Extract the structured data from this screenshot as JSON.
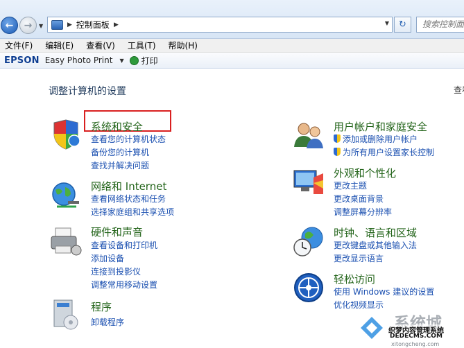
{
  "address_bar": {
    "path_item": "控制面板",
    "search_placeholder": "搜索控制面板"
  },
  "menu": [
    "文件(F)",
    "编辑(E)",
    "查看(V)",
    "工具(T)",
    "帮助(H)"
  ],
  "toolbar": {
    "brand": "EPSON",
    "app": "Easy Photo Print",
    "print": "打印"
  },
  "main": {
    "heading": "调整计算机的设置",
    "view_by": "查看方式"
  },
  "categories": {
    "system": {
      "title": "系统和安全",
      "links": [
        "查看您的计算机状态",
        "备份您的计算机",
        "查找并解决问题"
      ]
    },
    "network": {
      "title": "网络和 Internet",
      "links": [
        "查看网络状态和任务",
        "选择家庭组和共享选项"
      ]
    },
    "hardware": {
      "title": "硬件和声音",
      "links": [
        "查看设备和打印机",
        "添加设备",
        "连接到投影仪",
        "调整常用移动设置"
      ]
    },
    "programs": {
      "title": "程序",
      "links": [
        "卸载程序"
      ]
    },
    "users": {
      "title": "用户帐户和家庭安全",
      "links": [
        "添加或删除用户帐户",
        "为所有用户设置家长控制"
      ]
    },
    "appearance": {
      "title": "外观和个性化",
      "links": [
        "更改主题",
        "更改桌面背景",
        "调整屏幕分辨率"
      ]
    },
    "clock": {
      "title": "时钟、语言和区域",
      "links": [
        "更改键盘或其他输入法",
        "更改显示语言"
      ]
    },
    "ease": {
      "title": "轻松访问",
      "links": [
        "使用 Windows 建议的设置",
        "优化视频显示"
      ]
    }
  },
  "watermark": {
    "brand": "系统城",
    "line1": "织梦内容管理系统",
    "line2": "DEDECMS.COM",
    "line3": "xitongcheng.com"
  }
}
